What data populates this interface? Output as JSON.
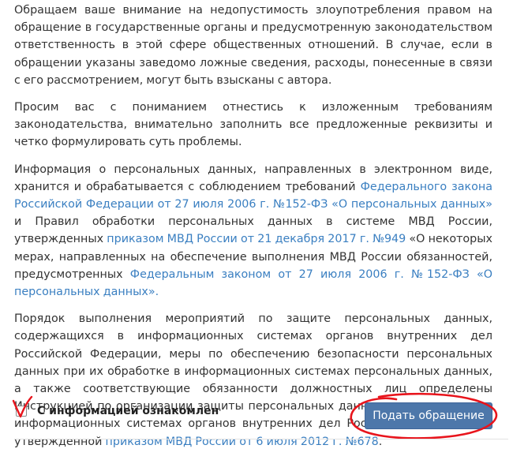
{
  "paragraphs": {
    "p1": "Обращаем ваше внимание на недопустимость злоупотребления правом на обращение в государственные органы и предусмотренную законодательством ответственность в этой сфере общественных отношений. В случае, если в обращении указаны заведомо ложные сведения, расходы, понесенные в связи с его рассмотрением, могут быть взысканы с автора.",
    "p2": "Просим вас с пониманием отнестись к изложенным требованиям законодательства, внимательно заполнить все предложенные реквизиты и четко формулировать суть проблемы.",
    "p3": {
      "t1": "Информация о персональных данных, направленных в электронном виде, хранится и обрабатывается с соблюдением требований ",
      "link1": "Федерального закона Российской Федерации от 27 июля 2006 г. №152-ФЗ «О персональных данных»",
      "t2": " и Правил обработки персональных данных в системе МВД России, утвержденных ",
      "link2": "приказом МВД России от 21 декабря 2017 г. №949",
      "t3": " «О некоторых мерах, направленных на обеспечение выполнения МВД России обязанностей, предусмотренных ",
      "link3": "Федеральным законом от 27 июля 2006 г. №152-ФЗ «О персональных данных».",
      "t4": ""
    },
    "p4": {
      "t1": "Порядок выполнения мероприятий по защите персональных данных, содержащихся в информационных системах органов внутренних дел Российской Федерации, меры по обеспечению безопасности персональных данных при их обработке в информационных системах персональных данных, а также соответствующие обязанности должностных лиц определены Инструкцией по организации защиты персональных данных, содержащихся в информационных системах органов внутренних дел Российской Федерации, утвержденной ",
      "link1": "приказом МВД России от 6 июля 2012 г. №678",
      "t2": "."
    }
  },
  "agreement": {
    "checkbox_label": "С информацией ознакомлен"
  },
  "actions": {
    "submit_label": "Подать обращение"
  },
  "colors": {
    "text": "#333333",
    "link": "#3a7fc1",
    "button": "#4d77aa",
    "annotation": "#e8141c"
  },
  "icons": {
    "check": "check-mark-icon"
  }
}
